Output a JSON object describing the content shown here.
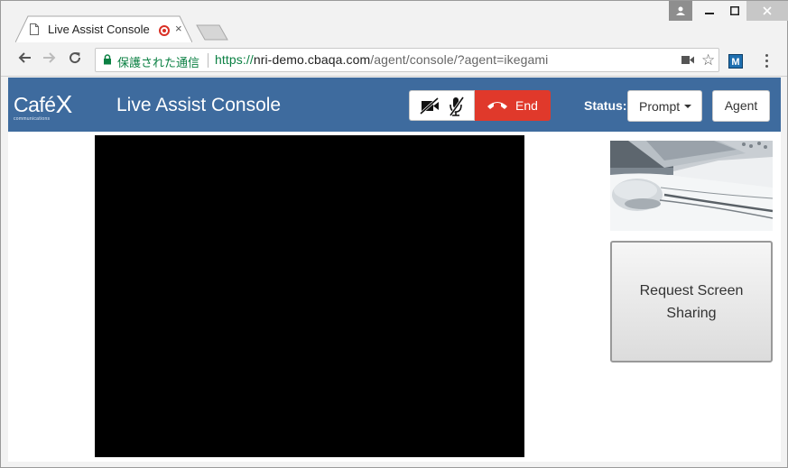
{
  "browser": {
    "tab_title": "Live Assist Console",
    "tab_close": "×",
    "secure_label": "保護された通信",
    "url_scheme": "https://",
    "url_host": "nri-demo.cbaqa.com",
    "url_path": "/agent/console/?agent=ikegami",
    "extension_label": "M"
  },
  "app": {
    "logo_text": "Café",
    "logo_x": "X",
    "logo_sub": "communications",
    "title": "Live Assist Console",
    "end_label": "End",
    "status_label": "Status:",
    "status_value": "Prompt",
    "agent_label": "Agent",
    "request_screen_label": "Request Screen Sharing"
  },
  "colors": {
    "header": "#3e6b9e",
    "end_button": "#e0392b",
    "secure_green": "#0b8043"
  }
}
